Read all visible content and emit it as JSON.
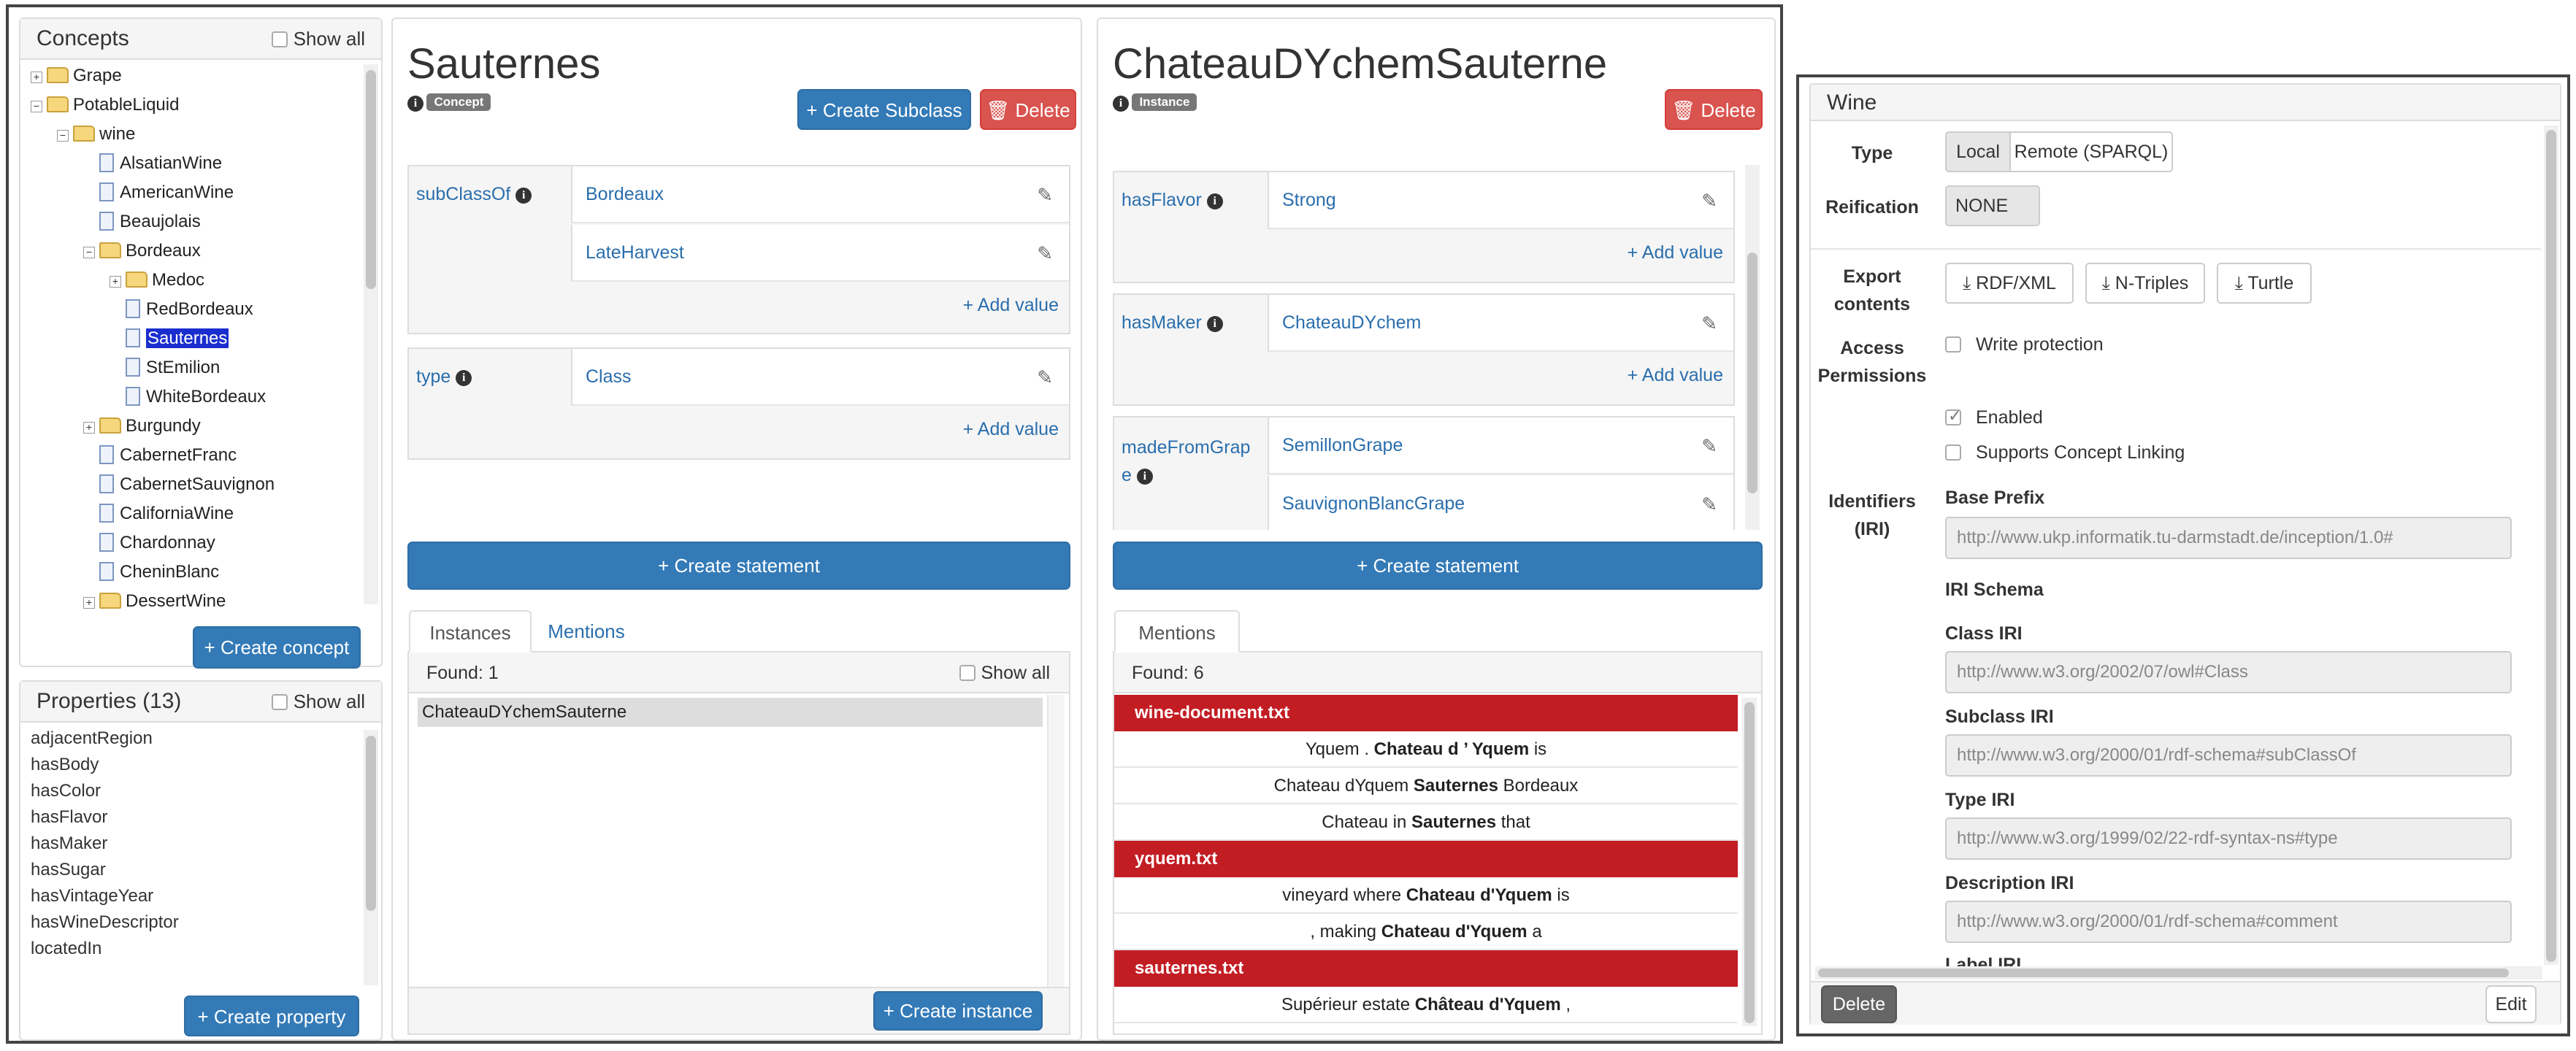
{
  "concepts": {
    "title": "Concepts",
    "show_all": "Show all",
    "tree": [
      {
        "label": "Grape",
        "kind": "folder",
        "toggle": "+",
        "indent": 0
      },
      {
        "label": "PotableLiquid",
        "kind": "folder",
        "toggle": "−",
        "indent": 0
      },
      {
        "label": "wine",
        "kind": "folder",
        "toggle": "−",
        "indent": 1
      },
      {
        "label": "AlsatianWine",
        "kind": "doc",
        "indent": 2
      },
      {
        "label": "AmericanWine",
        "kind": "doc",
        "indent": 2
      },
      {
        "label": "Beaujolais",
        "kind": "doc",
        "indent": 2
      },
      {
        "label": "Bordeaux",
        "kind": "folder",
        "toggle": "−",
        "indent": 2
      },
      {
        "label": "Medoc",
        "kind": "folder",
        "toggle": "+",
        "indent": 3
      },
      {
        "label": "RedBordeaux",
        "kind": "doc",
        "indent": 3
      },
      {
        "label": "Sauternes",
        "kind": "doc",
        "indent": 3,
        "selected": true
      },
      {
        "label": "StEmilion",
        "kind": "doc",
        "indent": 3
      },
      {
        "label": "WhiteBordeaux",
        "kind": "doc",
        "indent": 3
      },
      {
        "label": "Burgundy",
        "kind": "folder",
        "toggle": "+",
        "indent": 2
      },
      {
        "label": "CabernetFranc",
        "kind": "doc",
        "indent": 2
      },
      {
        "label": "CabernetSauvignon",
        "kind": "doc",
        "indent": 2
      },
      {
        "label": "CaliforniaWine",
        "kind": "doc",
        "indent": 2
      },
      {
        "label": "Chardonnay",
        "kind": "doc",
        "indent": 2
      },
      {
        "label": "CheninBlanc",
        "kind": "doc",
        "indent": 2
      },
      {
        "label": "DessertWine",
        "kind": "folder",
        "toggle": "+",
        "indent": 2
      }
    ],
    "create_button": "+ Create concept"
  },
  "properties": {
    "title": "Properties (13)",
    "show_all": "Show all",
    "items": [
      "adjacentRegion",
      "hasBody",
      "hasColor",
      "hasFlavor",
      "hasMaker",
      "hasSugar",
      "hasVintageYear",
      "hasWineDescriptor",
      "locatedIn"
    ],
    "create_button": "+ Create property"
  },
  "concept_detail": {
    "title": "Sauternes",
    "badge": "Concept",
    "create_subclass": "+ Create Subclass",
    "delete": "🗑 Delete",
    "statements": [
      {
        "property": "subClassOf",
        "values": [
          "Bordeaux",
          "LateHarvest"
        ],
        "add": "+ Add value"
      },
      {
        "property": "type",
        "values": [
          "Class"
        ],
        "add": "+ Add value"
      }
    ],
    "create_statement": "+ Create statement",
    "tabs": [
      "Instances",
      "Mentions"
    ],
    "found": "Found: 1",
    "show_all": "Show all",
    "instances": [
      "ChateauDYchemSauterne"
    ],
    "create_instance": "+ Create instance"
  },
  "instance_detail": {
    "title": "ChateauDYchemSauterne",
    "badge": "Instance",
    "delete": "🗑 Delete",
    "statements": [
      {
        "property": "hasFlavor",
        "values": [
          "Strong"
        ],
        "add": "+ Add value"
      },
      {
        "property": "hasMaker",
        "values": [
          "ChateauDYchem"
        ],
        "add": "+ Add value"
      },
      {
        "property": "madeFromGrape",
        "property_line1": "madeFromGrap",
        "property_line2": "e",
        "values": [
          "SemillonGrape",
          "SauvignonBlancGrape"
        ]
      }
    ],
    "create_statement": "+ Create statement",
    "tabs": [
      "Mentions"
    ],
    "found": "Found: 6",
    "mentions": [
      {
        "type": "doc",
        "text": "wine-document.txt"
      },
      {
        "type": "mention",
        "before": "Yquem . ",
        "bold": "Chateau d ’ Yquem",
        "after": " is"
      },
      {
        "type": "mention",
        "before": "Chateau dYquem ",
        "bold": "Sauternes",
        "after": " Bordeaux"
      },
      {
        "type": "mention",
        "before": "Chateau in ",
        "bold": "Sauternes",
        "after": " that"
      },
      {
        "type": "doc",
        "text": "yquem.txt"
      },
      {
        "type": "mention",
        "before": "vineyard where ",
        "bold": "Chateau d'Yquem",
        "after": " is"
      },
      {
        "type": "mention",
        "before": ", making ",
        "bold": "Chateau d'Yquem",
        "after": " a"
      },
      {
        "type": "doc",
        "text": "sauternes.txt"
      },
      {
        "type": "mention",
        "before": "Supérieur estate ",
        "bold": "Château d'Yquem",
        "after": " ,"
      }
    ]
  },
  "kb_settings": {
    "title": "Wine",
    "type_label": "Type",
    "type_options": [
      "Local",
      "Remote (SPARQL)"
    ],
    "reification_label": "Reification",
    "reification_value": "NONE",
    "export_label_1": "Export",
    "export_label_2": "contents",
    "export_buttons": [
      "RDF/XML",
      "N-Triples",
      "Turtle"
    ],
    "access_label_1": "Access",
    "access_label_2": "Permissions",
    "write_protection": "Write protection",
    "enabled": "Enabled",
    "concept_linking": "Supports Concept Linking",
    "identifiers_label_1": "Identifiers",
    "identifiers_label_2": "(IRI)",
    "base_prefix_label": "Base Prefix",
    "base_prefix": "http://www.ukp.informatik.tu-darmstadt.de/inception/1.0#",
    "iri_schema_label": "IRI Schema",
    "class_iri_label": "Class IRI",
    "class_iri": "http://www.w3.org/2002/07/owl#Class",
    "subclass_iri_label": "Subclass IRI",
    "subclass_iri": "http://www.w3.org/2000/01/rdf-schema#subClassOf",
    "type_iri_label": "Type IRI",
    "type_iri": "http://www.w3.org/1999/02/22-rdf-syntax-ns#type",
    "description_iri_label": "Description IRI",
    "description_iri": "http://www.w3.org/2000/01/rdf-schema#comment",
    "label_iri_label": "Label IRI",
    "delete": "Delete",
    "edit": "Edit"
  }
}
